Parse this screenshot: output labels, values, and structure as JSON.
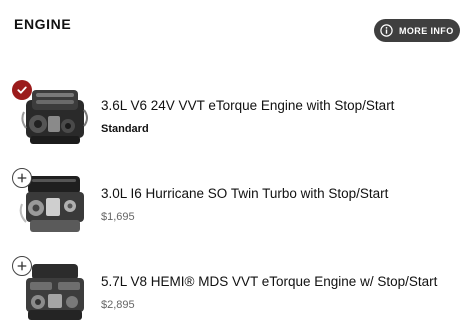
{
  "header": {
    "title": "ENGINE",
    "more_info_label": "MORE INFO"
  },
  "options": [
    {
      "name": "3.6L V6 24V VVT eTorque Engine with Stop/Start",
      "detail": "Standard",
      "selected": true
    },
    {
      "name": "3.0L I6 Hurricane SO Twin Turbo with Stop/Start",
      "detail": "$1,695",
      "selected": false
    },
    {
      "name": "5.7L V8 HEMI® MDS VVT eTorque Engine w/ Stop/Start",
      "detail": "$2,895",
      "selected": false
    }
  ],
  "colors": {
    "selected_accent": "#9b1b1b",
    "button_bg": "#3f3f3f",
    "price_text": "#666666"
  }
}
